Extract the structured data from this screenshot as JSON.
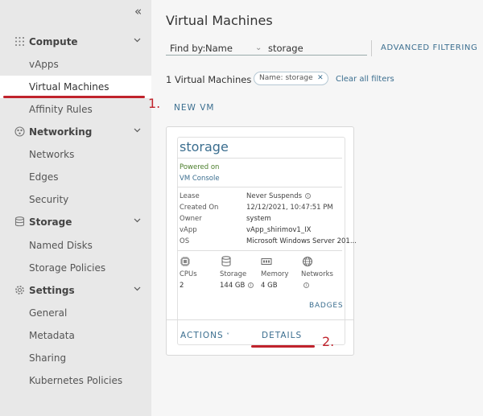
{
  "sidebar": {
    "collapse_glyph": "«",
    "groups": [
      {
        "label": "Compute",
        "icon": "grid-icon",
        "items": [
          "vApps",
          "Virtual Machines",
          "Affinity Rules"
        ]
      },
      {
        "label": "Networking",
        "icon": "network-icon",
        "items": [
          "Networks",
          "Edges",
          "Security"
        ]
      },
      {
        "label": "Storage",
        "icon": "database-icon",
        "items": [
          "Named Disks",
          "Storage Policies"
        ]
      },
      {
        "label": "Settings",
        "icon": "gear-icon",
        "items": [
          "General",
          "Metadata",
          "Sharing",
          "Kubernetes Policies"
        ]
      }
    ],
    "active_item": "Virtual Machines"
  },
  "annotations": {
    "step1": "1.",
    "step2": "2.",
    "color": "#c0232c"
  },
  "main": {
    "title": "Virtual Machines",
    "find_label": "Find by:",
    "find_by": "Name",
    "search_value": "storage",
    "advanced_filtering": "ADVANCED FILTERING",
    "result_count": "1 Virtual Machines",
    "filter_chip": "Name: storage",
    "clear_all": "Clear all filters",
    "new_vm": "NEW VM"
  },
  "card": {
    "name": "storage",
    "status": "Powered on",
    "console": "VM Console",
    "props": [
      {
        "label": "Lease",
        "value": "Never Suspends"
      },
      {
        "label": "Created On",
        "value": "12/12/2021, 10:47:51 PM"
      },
      {
        "label": "Owner",
        "value": "system"
      },
      {
        "label": "vApp",
        "value": "vApp_shirimov1_IX"
      },
      {
        "label": "OS",
        "value": "Microsoft Windows Server 201..."
      }
    ],
    "resources": [
      {
        "label": "CPUs",
        "value": "2",
        "icon": "cpu-icon"
      },
      {
        "label": "Storage",
        "value": "144 GB",
        "icon": "storage-icon"
      },
      {
        "label": "Memory",
        "value": "4 GB",
        "icon": "memory-icon"
      },
      {
        "label": "Networks",
        "value": "",
        "icon": "globe-icon"
      }
    ],
    "badges": "BADGES",
    "actions": "ACTIONS",
    "details": "DETAILS"
  },
  "colors": {
    "accent": "#3b6e8f",
    "powered_on": "#4a7d2a",
    "sidebar_bg": "#e8e8e8"
  }
}
